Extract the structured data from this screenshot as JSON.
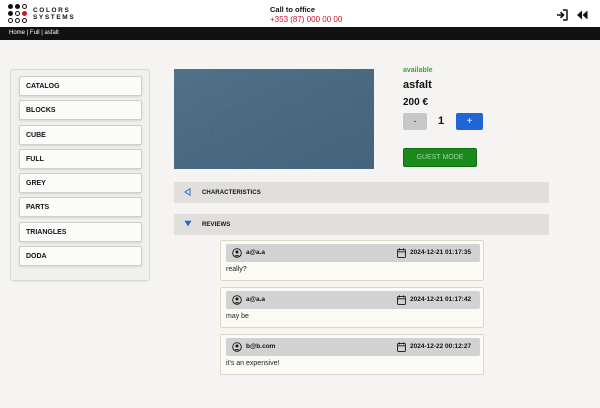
{
  "brand": {
    "line1": "COLORS",
    "line2": "SYSTEMS"
  },
  "header": {
    "call_label": "Call to office",
    "phone": "+353 (87) 000 00 00",
    "icons": [
      "login-icon",
      "back-icon"
    ]
  },
  "breadcrumb": {
    "text": "Home | Full | asfalt"
  },
  "sidebar": {
    "items": [
      {
        "label": "CATALOG"
      },
      {
        "label": "BLOCKS"
      },
      {
        "label": "CUBE"
      },
      {
        "label": "FULL"
      },
      {
        "label": "GREY"
      },
      {
        "label": "PARTS"
      },
      {
        "label": "TRIANGLES"
      },
      {
        "label": "DODA"
      }
    ]
  },
  "product": {
    "availability": "available",
    "name": "asfalt",
    "price": "200 €",
    "minus_label": "-",
    "quantity": "1",
    "plus_label": "+",
    "guest_button": "GUEST MODE"
  },
  "sections": {
    "characteristics": "CHARACTERISTICS",
    "reviews": "REVIEWS"
  },
  "reviews": [
    {
      "user": "a@a.a",
      "date": "2024-12-21 01:17:35",
      "text": "really?"
    },
    {
      "user": "a@a.a",
      "date": "2024-12-21 01:17:42",
      "text": "may be"
    },
    {
      "user": "b@b.com",
      "date": "2024-12-22 00:12:27",
      "text": "it's an expensive!"
    }
  ],
  "colors": {
    "accent": "#1f65d6",
    "brand_red": "#c9142b",
    "available_green": "#2bb02b",
    "guest_green": "#1a8a1a",
    "header_dark": "#111111",
    "swatch": "#3f607b"
  }
}
